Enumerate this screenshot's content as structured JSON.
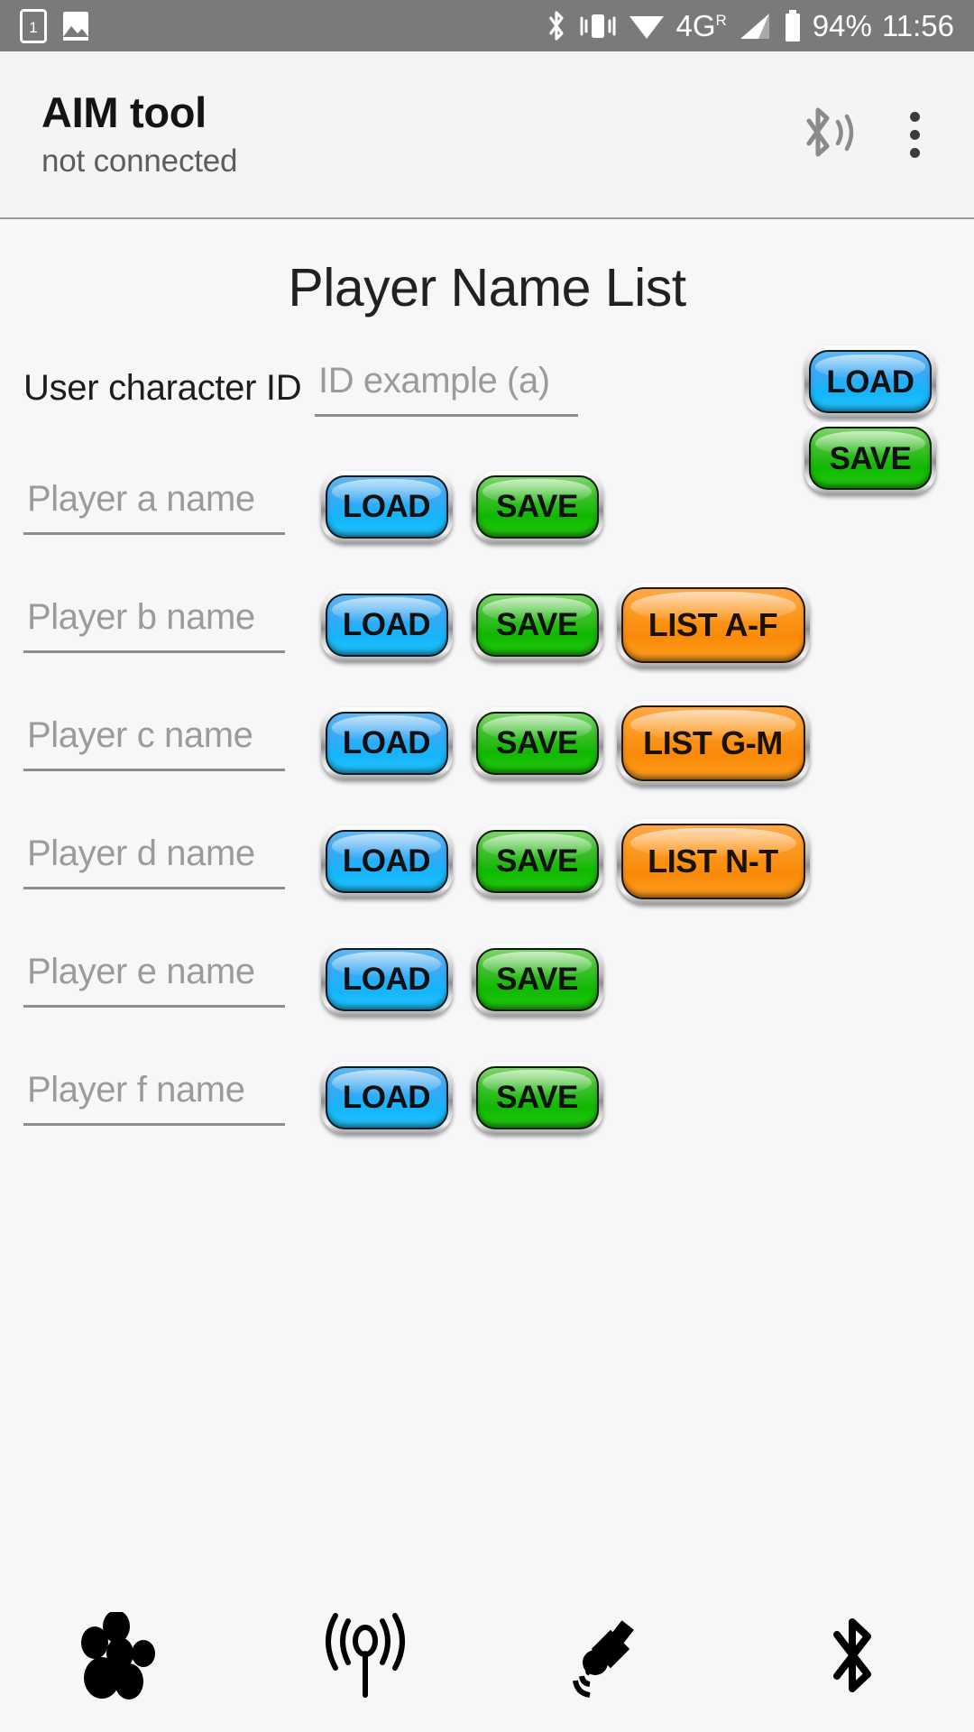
{
  "status_bar": {
    "icons_left": [
      "sim-card-1-icon",
      "gallery-image-icon"
    ],
    "icons_right": [
      "bluetooth-icon",
      "vibrate-icon",
      "wifi-icon",
      "signal-bars-icon",
      "battery-icon"
    ],
    "network": "4G",
    "network_sup": "R",
    "battery": "94%",
    "time": "11:56",
    "background": "#7a7a7a"
  },
  "app_bar": {
    "title": "AIM tool",
    "subtitle": "not connected",
    "bluetooth_audio_icon": "bluetooth-audio-icon",
    "overflow_icon": "overflow-menu-icon"
  },
  "page": {
    "title": "Player Name List"
  },
  "id_row": {
    "label": "User character ID",
    "placeholder": "ID example (a)",
    "value": "",
    "load_label": "LOAD",
    "save_label": "SAVE"
  },
  "rows": [
    {
      "id": "a",
      "placeholder": "Player a name",
      "value": "",
      "load_label": "LOAD",
      "save_label": "SAVE",
      "list_label": ""
    },
    {
      "id": "b",
      "placeholder": "Player b name",
      "value": "",
      "load_label": "LOAD",
      "save_label": "SAVE",
      "list_label": "LIST A-F"
    },
    {
      "id": "c",
      "placeholder": "Player c name",
      "value": "",
      "load_label": "LOAD",
      "save_label": "SAVE",
      "list_label": "LIST G-M"
    },
    {
      "id": "d",
      "placeholder": "Player d name",
      "value": "",
      "load_label": "LOAD",
      "save_label": "SAVE",
      "list_label": "LIST N-T"
    },
    {
      "id": "e",
      "placeholder": "Player e name",
      "value": "",
      "load_label": "LOAD",
      "save_label": "SAVE",
      "list_label": ""
    },
    {
      "id": "f",
      "placeholder": "Player f name",
      "value": "",
      "load_label": "LOAD",
      "save_label": "SAVE",
      "list_label": ""
    }
  ],
  "bottom_nav": [
    {
      "icon": "group-people-icon"
    },
    {
      "icon": "antenna-broadcast-icon"
    },
    {
      "icon": "satellite-icon"
    },
    {
      "icon": "bluetooth-icon"
    }
  ],
  "colors": {
    "load_blue": "#15b4fb",
    "save_green": "#10b800",
    "list_orange": "#f98a08",
    "status_bar_gray": "#7a7a7a",
    "page_bg": "#f7f7f9"
  }
}
